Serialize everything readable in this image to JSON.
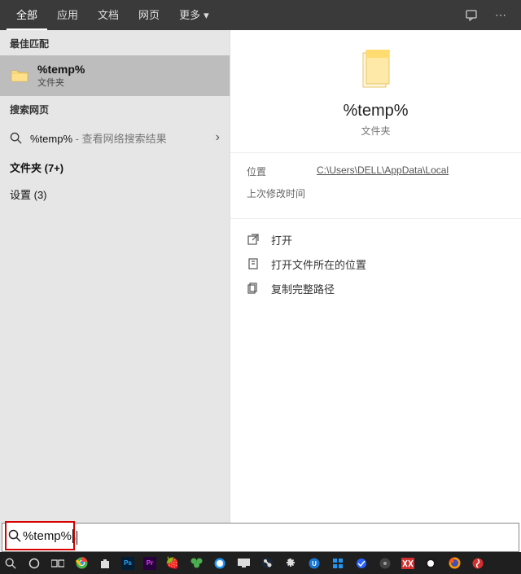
{
  "tabs": {
    "all": "全部",
    "apps": "应用",
    "docs": "文档",
    "web": "网页",
    "more": "更多"
  },
  "left": {
    "best_header": "最佳匹配",
    "best_title": "%temp%",
    "best_sub": "文件夹",
    "web_header": "搜索网页",
    "web_query": "%temp%",
    "web_hint": " - 查看网络搜索结果",
    "folders": "文件夹 (7+)",
    "settings": "设置 (3)"
  },
  "preview": {
    "title": "%temp%",
    "sub": "文件夹",
    "loc_label": "位置",
    "loc_value": "C:\\Users\\DELL\\AppData\\Local",
    "mod_label": "上次修改时间"
  },
  "actions": {
    "open": "打开",
    "open_loc": "打开文件所在的位置",
    "copy": "复制完整路径"
  },
  "search": {
    "query": "%temp%"
  }
}
